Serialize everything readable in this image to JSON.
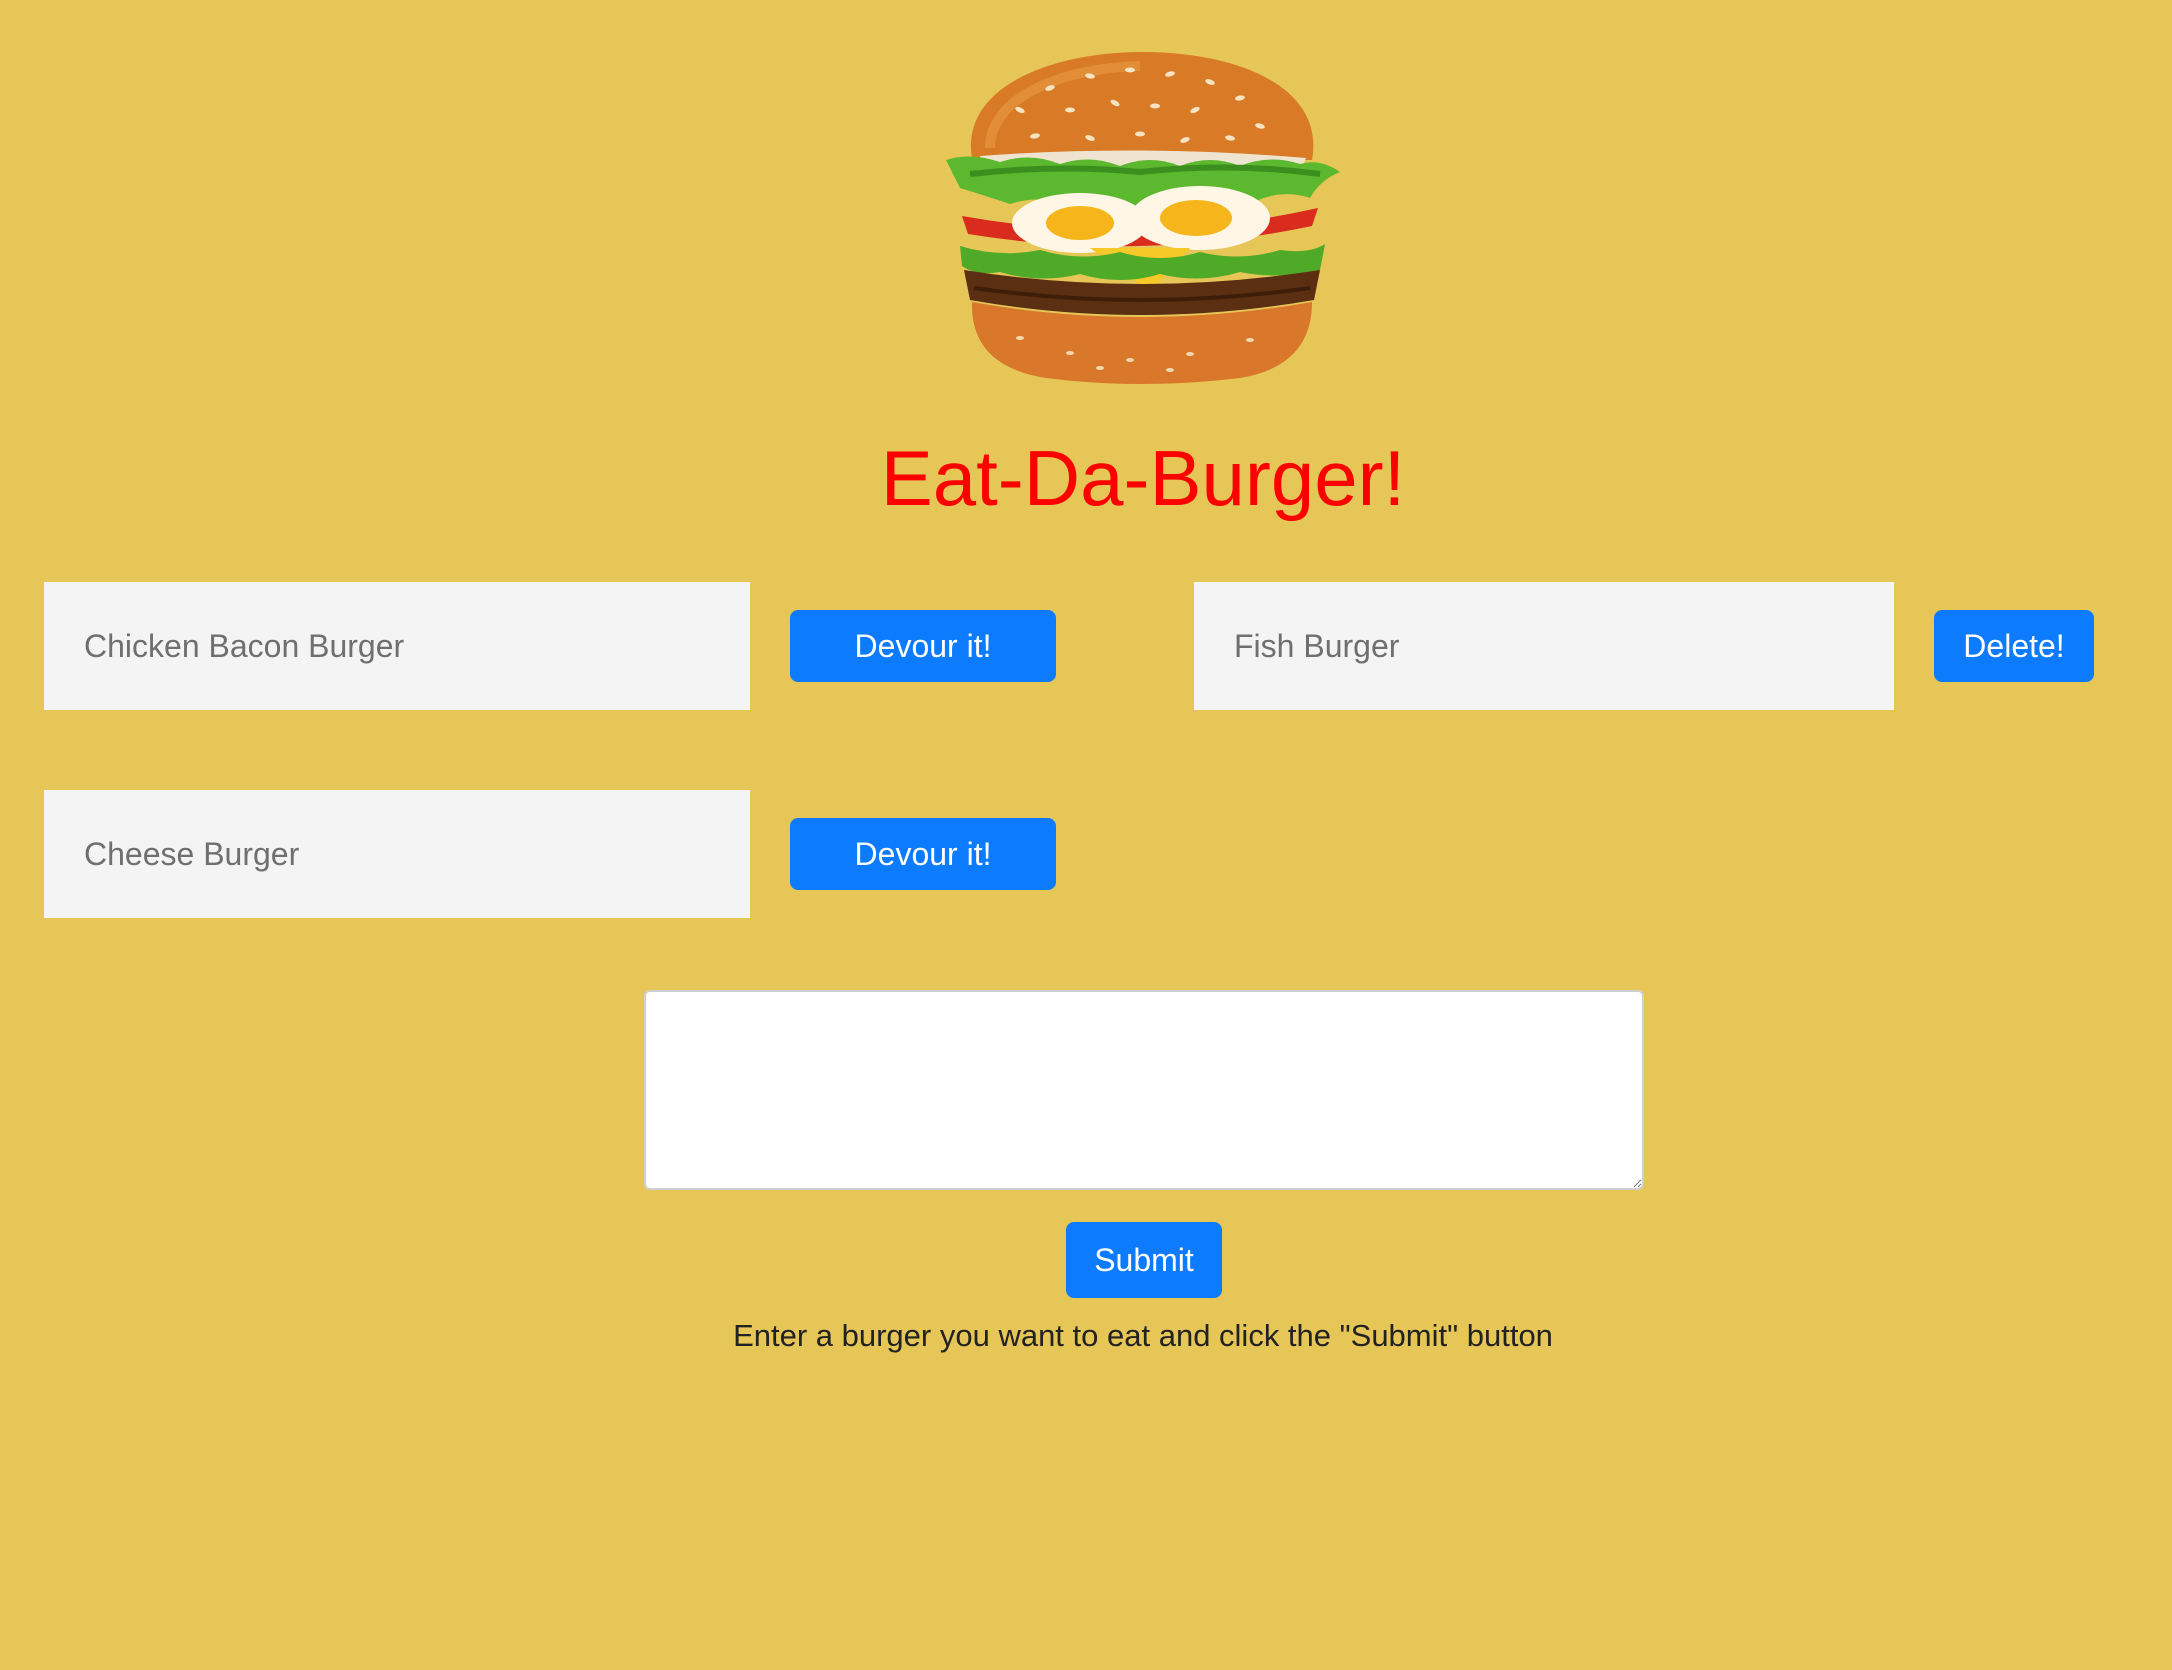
{
  "header": {
    "title": "Eat-Da-Burger!",
    "logo_icon": "burger-logo-icon"
  },
  "uneaten_burgers": [
    {
      "name": "Chicken Bacon Burger",
      "action_label": "Devour it!"
    },
    {
      "name": "Cheese Burger",
      "action_label": "Devour it!"
    }
  ],
  "eaten_burgers": [
    {
      "name": "Fish Burger",
      "action_label": "Delete!"
    }
  ],
  "form": {
    "textarea_value": "",
    "submit_label": "Submit",
    "help_text": "Enter a burger you want to eat and click the \"Submit\" button"
  },
  "colors": {
    "background": "#e5c656",
    "title": "#ff0000",
    "button": "#0d7bfd",
    "item_box": "#f4f4f4"
  }
}
